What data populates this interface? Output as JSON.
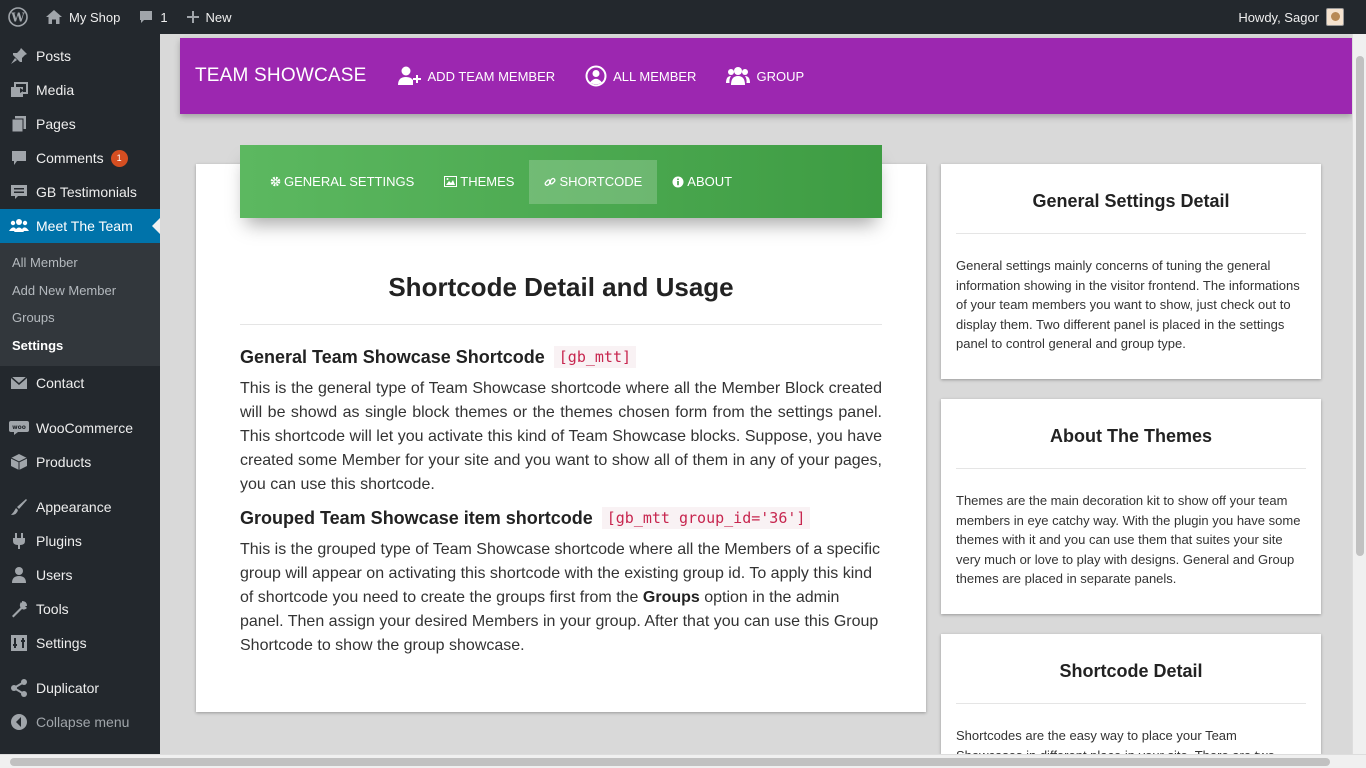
{
  "adminbar": {
    "site_name": "My Shop",
    "comments_count": "1",
    "new_label": "New",
    "howdy": "Howdy, Sagor"
  },
  "sidebar": {
    "items": [
      {
        "label": "Posts",
        "icon": "pin-icon"
      },
      {
        "label": "Media",
        "icon": "media-icon"
      },
      {
        "label": "Pages",
        "icon": "pages-icon"
      },
      {
        "label": "Comments",
        "icon": "comment-icon",
        "badge": "1"
      },
      {
        "label": "GB Testimonials",
        "icon": "testimonial-icon"
      },
      {
        "label": "Meet The Team",
        "icon": "team-icon"
      }
    ],
    "submenu": [
      "All Member",
      "Add New Member",
      "Groups",
      "Settings"
    ],
    "items2": [
      {
        "label": "Contact",
        "icon": "mail-icon"
      },
      {
        "label": "WooCommerce",
        "icon": "woo-icon"
      },
      {
        "label": "Products",
        "icon": "box-icon"
      },
      {
        "label": "Appearance",
        "icon": "brush-icon"
      },
      {
        "label": "Plugins",
        "icon": "plug-icon"
      },
      {
        "label": "Users",
        "icon": "user-icon"
      },
      {
        "label": "Tools",
        "icon": "wrench-icon"
      },
      {
        "label": "Settings",
        "icon": "settings-icon"
      },
      {
        "label": "Duplicator",
        "icon": "share-icon"
      }
    ],
    "collapse": "Collapse menu"
  },
  "header": {
    "brand": "TEAM SHOWCASE",
    "nav": [
      "ADD TEAM MEMBER",
      "ALL MEMBER",
      "GROUP"
    ]
  },
  "tabs": [
    "GENERAL SETTINGS",
    "THEMES",
    "SHORTCODE",
    "ABOUT"
  ],
  "main": {
    "title": "Shortcode Detail and Usage",
    "section1_title": "General Team Showcase Shortcode",
    "section1_code": "[gb_mtt]",
    "section1_text": "This is the general type of Team Showcase shortcode where all the Member Block created will be showd as single block themes or the themes chosen form from the settings panel. This shortcode will let you activate this kind of Team Showcase blocks. Suppose, you have created some Member for your site and you want to show all of them in any of your pages, you can use this shortcode.",
    "section2_title": "Grouped Team Showcase item shortcode",
    "section2_code": "[gb_mtt group_id='36']",
    "section2_text_a": "This is the grouped type of Team Showcase shortcode where all the Members of a specific group will appear on activating this shortcode with the existing group id. To apply this kind of shortcode you need to create the groups first from the ",
    "section2_bold": "Groups",
    "section2_text_b": " option in the admin panel. Then assign your desired Members in your group. After that you can use this Group Shortcode to show the group showcase."
  },
  "cards": [
    {
      "title": "General Settings Detail",
      "text": "General settings mainly concerns of tuning the general information showing in the visitor frontend. The informations of your team members you want to show, just check out to display them. Two different panel is placed in the settings panel to control general and group type."
    },
    {
      "title": "About The Themes",
      "text": "Themes are the main decoration kit to show off your team members in eye catchy way. With the plugin you have some themes with it and you can use them that suites your site very much or love to play with designs. General and Group themes are placed in separate panels."
    },
    {
      "title": "Shortcode Detail",
      "text": "Shortcodes are the easy way to place your Team Showcases in different place in your site. There are two"
    }
  ],
  "colors": {
    "header": "#9c27b0",
    "tabs": "#4caf50",
    "admin": "#23282d",
    "current": "#0073aa"
  }
}
